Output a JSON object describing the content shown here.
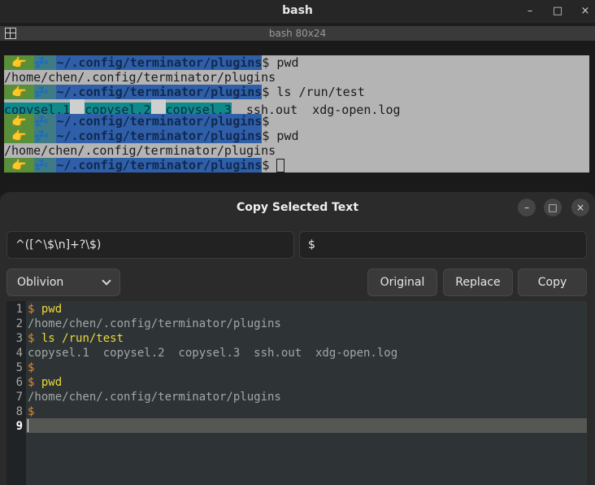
{
  "terminal": {
    "title": "bash",
    "tab_title": "bash 80x24",
    "prompt": {
      "user_icons": " 👉 ",
      "host_icons": "💤 ",
      "dir": "~/.config/terminator/plugins"
    },
    "lines": [
      {
        "type": "prompt",
        "cmd": "$ pwd"
      },
      {
        "type": "output",
        "text": "/home/chen/.config/terminator/plugins"
      },
      {
        "type": "prompt",
        "cmd": "$ ls /run/test"
      },
      {
        "type": "ls",
        "items": [
          "copysel.1",
          "copysel.2",
          "copysel.3"
        ],
        "rest": "ssh.out  xdg-open.log"
      },
      {
        "type": "prompt",
        "cmd": "$"
      },
      {
        "type": "prompt",
        "cmd": "$ pwd"
      },
      {
        "type": "output",
        "text": "/home/chen/.config/terminator/plugins"
      },
      {
        "type": "prompt",
        "cmd": "$ "
      }
    ]
  },
  "dialog": {
    "title": "Copy Selected Text",
    "pattern_value": "^([^\\$\\n]+?\\$)",
    "replacement_value": "$",
    "theme_selected": "Oblivion",
    "buttons": {
      "original": "Original",
      "replace": "Replace",
      "copy": "Copy"
    },
    "window_controls": {
      "minimize": "–",
      "maximize": "□",
      "close": "×"
    }
  },
  "editor": {
    "current_line": 9,
    "lines": [
      {
        "n": "1",
        "dollar": "$",
        "cmd": " pwd",
        "text": ""
      },
      {
        "n": "2",
        "dollar": "",
        "cmd": "",
        "text": "/home/chen/.config/terminator/plugins"
      },
      {
        "n": "3",
        "dollar": "$",
        "cmd": " ls /run/test",
        "text": ""
      },
      {
        "n": "4",
        "dollar": "",
        "cmd": "",
        "text": "copysel.1  copysel.2  copysel.3  ssh.out  xdg-open.log"
      },
      {
        "n": "5",
        "dollar": "$",
        "cmd": "",
        "text": ""
      },
      {
        "n": "6",
        "dollar": "$",
        "cmd": " pwd",
        "text": ""
      },
      {
        "n": "7",
        "dollar": "",
        "cmd": "",
        "text": "/home/chen/.config/terminator/plugins"
      },
      {
        "n": "8",
        "dollar": "$",
        "cmd": "",
        "text": ""
      },
      {
        "n": "9",
        "dollar": "",
        "cmd": "",
        "text": ""
      }
    ]
  },
  "colors": {
    "prompt_user_bg": "#5a8f3a",
    "prompt_host_bg": "#3e7b86",
    "prompt_dir_bg": "#2f5fa8",
    "selection_bg": "#b4b4b4",
    "editor_bg": "#2e3436",
    "editor_dollar": "#e0882a",
    "editor_cmd": "#ecd83a"
  }
}
